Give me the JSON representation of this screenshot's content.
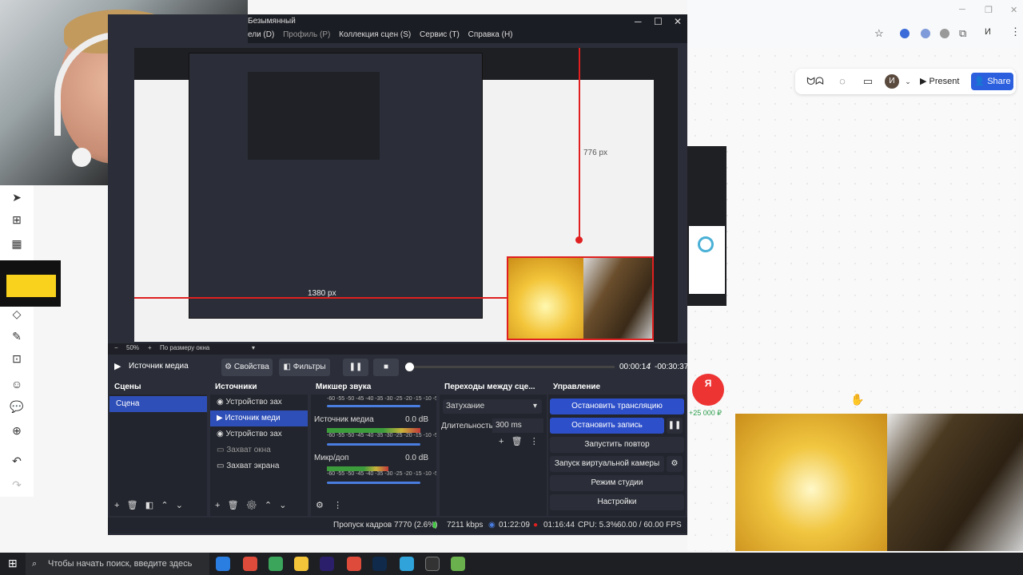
{
  "obs": {
    "menu": [
      "ели (D)",
      "Профиль (P)",
      "Коллекция сцен (S)",
      "Сервис (T)",
      "Справка (H)"
    ],
    "title": "Безымянный",
    "zoom": "50%",
    "zoom_mode": "По размеру окна",
    "media": {
      "label": "Источник медиа",
      "properties": "Свойства",
      "filters": "Фильтры",
      "time_current": "00:00:14",
      "time_sep": "/",
      "time_remaining": "-00:30:37",
      "progress": 0.01
    },
    "measure_v": "776 px",
    "measure_h": "1380 px",
    "scenes": {
      "title": "Сцены",
      "items": [
        "Сцена"
      ]
    },
    "sources": {
      "title": "Источники",
      "items": [
        "Устройство зах",
        "Источник меди",
        "Устройство зах",
        "Захват окна",
        "Захват экрана"
      ]
    },
    "mixer": {
      "title": "Микшер звука",
      "scale": "-60 -55 -50 -45 -40 -35 -30 -25 -20 -15 -10 -5 0",
      "channels": [
        {
          "name": "Источник медиа",
          "db": "0.0 dB"
        },
        {
          "name": "Микр/доп",
          "db": "0.0 dB"
        }
      ]
    },
    "transitions": {
      "title": "Переходы между сце...",
      "type": "Затухание",
      "duration_label": "Длительность",
      "duration": "300 ms"
    },
    "controls": {
      "title": "Управление",
      "stop_stream": "Остановить трансляцию",
      "stop_record": "Остановить запись",
      "replay": "Запустить повтор",
      "virtual_cam": "Запуск виртуальной камеры",
      "studio": "Режим студии",
      "settings": "Настройки"
    },
    "status": {
      "dropped": "Пропуск кадров 7770 (2.6%)",
      "bitrate": "7211 kbps",
      "stream_time": "01:22:09",
      "rec_time": "01:16:44",
      "cpu": "CPU: 5.3%",
      "fps": "60.00 / 60.00 FPS"
    }
  },
  "board": {
    "present": "Present",
    "share": "Share",
    "avatar": "И",
    "yandex_logo": "Я",
    "yandex_money": "+25 000 ₽"
  },
  "taskbar": {
    "search_placeholder": "Чтобы начать поиск, введите здесь"
  }
}
